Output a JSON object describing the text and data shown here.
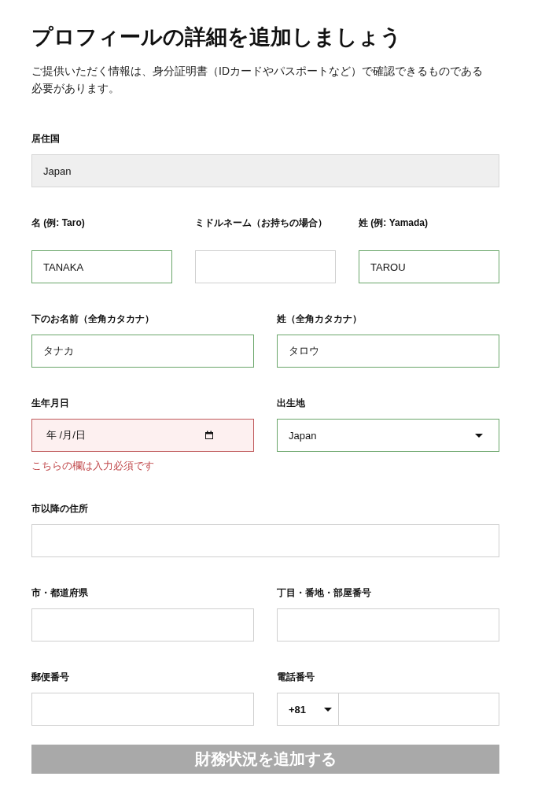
{
  "title": "プロフィールの詳細を追加しましょう",
  "description": "ご提供いただく情報は、身分証明書（IDカードやパスポートなど）で確認できるものである必要があります。",
  "rows": [
    {
      "fields": [
        {
          "label": "居住国",
          "kind": "text",
          "value": "Japan",
          "valid": false,
          "invalid": false,
          "disabled": true
        }
      ]
    },
    {
      "fields": [
        {
          "label": "名 (例: Taro)",
          "kind": "text",
          "value": "TANAKA",
          "valid": true,
          "invalid": false,
          "disabled": false
        },
        {
          "label": "ミドルネーム（お持ちの場合）",
          "kind": "text",
          "valid": false,
          "invalid": false,
          "disabled": false
        },
        {
          "label": "姓 (例: Yamada)",
          "kind": "text",
          "value": "TAROU",
          "valid": true,
          "invalid": false,
          "disabled": false
        }
      ]
    },
    {
      "fields": [
        {
          "label": "下のお名前（全角カタカナ）",
          "kind": "text",
          "value": "タナカ",
          "valid": true,
          "invalid": false,
          "disabled": false
        },
        {
          "label": "姓（全角カタカナ）",
          "kind": "text",
          "value": "タロウ",
          "valid": true,
          "invalid": false,
          "disabled": false
        }
      ]
    },
    {
      "fields": [
        {
          "label": "生年月日",
          "kind": "date",
          "placeholder": "年 /月/日",
          "valid": false,
          "invalid": true,
          "disabled": false,
          "error": "こちらの欄は入力必須です"
        },
        {
          "label": "出生地",
          "kind": "select",
          "value": "Japan",
          "valid": true,
          "invalid": false,
          "disabled": false
        }
      ]
    },
    {
      "fields": [
        {
          "label": "市以降の住所",
          "kind": "text",
          "valid": false,
          "invalid": false,
          "disabled": false
        }
      ]
    },
    {
      "fields": [
        {
          "label": "市・都道府県",
          "kind": "text",
          "valid": false,
          "invalid": false,
          "disabled": false
        },
        {
          "label": "丁目・番地・部屋番号",
          "kind": "text",
          "valid": false,
          "invalid": false,
          "disabled": false
        }
      ]
    },
    {
      "fields": [
        {
          "label": "郵便番号",
          "kind": "text",
          "valid": false,
          "invalid": false,
          "disabled": false
        },
        {
          "label": "電話番号",
          "kind": "phone",
          "code": "+81",
          "valid": false,
          "invalid": false,
          "disabled": false
        }
      ]
    }
  ],
  "submit": {
    "label": "財務状況を追加する",
    "disabled": true
  }
}
